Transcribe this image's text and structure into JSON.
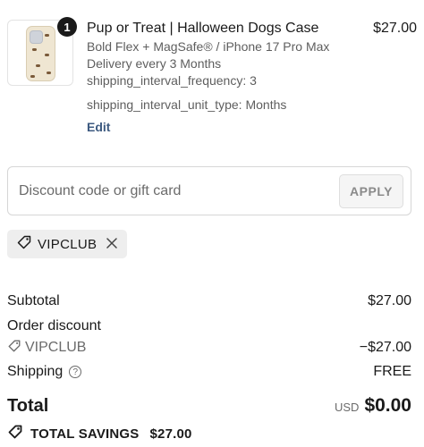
{
  "line_item": {
    "quantity": "1",
    "title": "Pup or Treat | Halloween Dogs Case",
    "variant": "Bold Flex + MagSafe® / iPhone 17 Pro Max",
    "delivery": "Delivery every 3 Months",
    "prop_frequency": "shipping_interval_frequency: 3",
    "prop_unit_type": "shipping_interval_unit_type: Months",
    "edit_label": "Edit",
    "price": "$27.00"
  },
  "discount": {
    "placeholder": "Discount code or gift card",
    "value": "",
    "apply_label": "APPLY"
  },
  "applied_code": {
    "code": "VIPCLUB",
    "remove_icon": "close-icon",
    "tag_icon": "tag-icon"
  },
  "summary": {
    "subtotal_label": "Subtotal",
    "subtotal_value": "$27.00",
    "order_discount_label": "Order discount",
    "discount_code": "VIPCLUB",
    "discount_value": "−$27.00",
    "shipping_label": "Shipping",
    "shipping_value": "FREE",
    "total_label": "Total",
    "currency": "USD",
    "total_value": "$0.00",
    "savings_label": "TOTAL SAVINGS",
    "savings_value": "$27.00"
  },
  "colors": {
    "text": "#1a1a1a",
    "muted": "#6b6b6b",
    "link": "#3d5a80",
    "chip_bg": "#eeeeee"
  }
}
